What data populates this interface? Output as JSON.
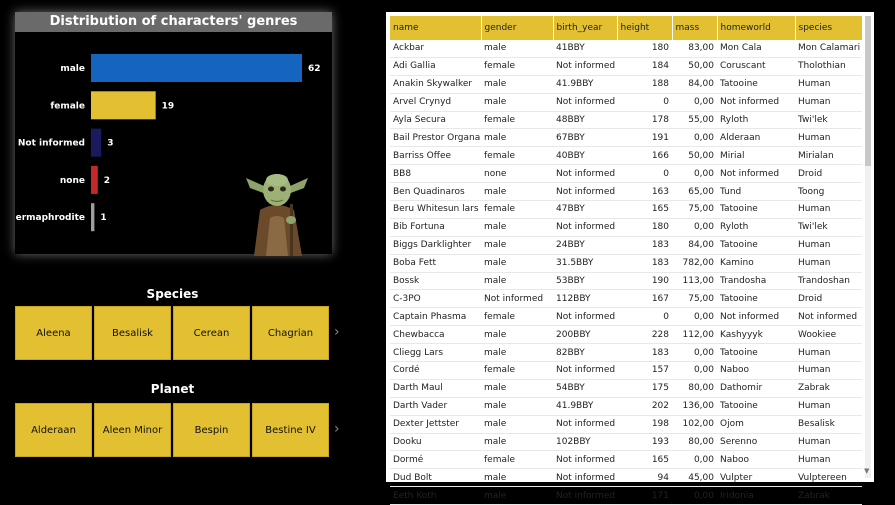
{
  "chart_data": {
    "type": "bar",
    "orientation": "horizontal",
    "title": "Distribution of characters' genres",
    "categories": [
      "male",
      "female",
      "Not informed",
      "none",
      "hermaphrodite"
    ],
    "values": [
      62,
      19,
      3,
      2,
      1
    ],
    "colors": [
      "#1565c0",
      "#e3c032",
      "#1a1a5e",
      "#c62828",
      "#9e9e9e"
    ]
  },
  "species_slicer": {
    "title": "Species",
    "items": [
      "Aleena",
      "Besalisk",
      "Cerean",
      "Chagrian"
    ]
  },
  "planet_slicer": {
    "title": "Planet",
    "items": [
      "Alderaan",
      "Aleen Minor",
      "Bespin",
      "Bestine IV"
    ]
  },
  "table": {
    "columns": [
      "name",
      "gender",
      "birth_year",
      "height",
      "mass",
      "homeworld",
      "species"
    ],
    "rows": [
      [
        "Ackbar",
        "male",
        "41BBY",
        "180",
        "83,00",
        "Mon Cala",
        "Mon Calamari"
      ],
      [
        "Adi Gallia",
        "female",
        "Not informed",
        "184",
        "50,00",
        "Coruscant",
        "Tholothian"
      ],
      [
        "Anakin Skywalker",
        "male",
        "41.9BBY",
        "188",
        "84,00",
        "Tatooine",
        "Human"
      ],
      [
        "Arvel Crynyd",
        "male",
        "Not informed",
        "0",
        "0,00",
        "Not informed",
        "Human"
      ],
      [
        "Ayla Secura",
        "female",
        "48BBY",
        "178",
        "55,00",
        "Ryloth",
        "Twi'lek"
      ],
      [
        "Bail Prestor Organa",
        "male",
        "67BBY",
        "191",
        "0,00",
        "Alderaan",
        "Human"
      ],
      [
        "Barriss Offee",
        "female",
        "40BBY",
        "166",
        "50,00",
        "Mirial",
        "Mirialan"
      ],
      [
        "BB8",
        "none",
        "Not informed",
        "0",
        "0,00",
        "Not informed",
        "Droid"
      ],
      [
        "Ben Quadinaros",
        "male",
        "Not informed",
        "163",
        "65,00",
        "Tund",
        "Toong"
      ],
      [
        "Beru Whitesun lars",
        "female",
        "47BBY",
        "165",
        "75,00",
        "Tatooine",
        "Human"
      ],
      [
        "Bib Fortuna",
        "male",
        "Not informed",
        "180",
        "0,00",
        "Ryloth",
        "Twi'lek"
      ],
      [
        "Biggs Darklighter",
        "male",
        "24BBY",
        "183",
        "84,00",
        "Tatooine",
        "Human"
      ],
      [
        "Boba Fett",
        "male",
        "31.5BBY",
        "183",
        "782,00",
        "Kamino",
        "Human"
      ],
      [
        "Bossk",
        "male",
        "53BBY",
        "190",
        "113,00",
        "Trandosha",
        "Trandoshan"
      ],
      [
        "C-3PO",
        "Not informed",
        "112BBY",
        "167",
        "75,00",
        "Tatooine",
        "Droid"
      ],
      [
        "Captain Phasma",
        "female",
        "Not informed",
        "0",
        "0,00",
        "Not informed",
        "Not informed"
      ],
      [
        "Chewbacca",
        "male",
        "200BBY",
        "228",
        "112,00",
        "Kashyyyk",
        "Wookiee"
      ],
      [
        "Cliegg Lars",
        "male",
        "82BBY",
        "183",
        "0,00",
        "Tatooine",
        "Human"
      ],
      [
        "Cordé",
        "female",
        "Not informed",
        "157",
        "0,00",
        "Naboo",
        "Human"
      ],
      [
        "Darth Maul",
        "male",
        "54BBY",
        "175",
        "80,00",
        "Dathomir",
        "Zabrak"
      ],
      [
        "Darth Vader",
        "male",
        "41.9BBY",
        "202",
        "136,00",
        "Tatooine",
        "Human"
      ],
      [
        "Dexter Jettster",
        "male",
        "Not informed",
        "198",
        "102,00",
        "Ojom",
        "Besalisk"
      ],
      [
        "Dooku",
        "male",
        "102BBY",
        "193",
        "80,00",
        "Serenno",
        "Human"
      ],
      [
        "Dormé",
        "female",
        "Not informed",
        "165",
        "0,00",
        "Naboo",
        "Human"
      ],
      [
        "Dud Bolt",
        "male",
        "Not informed",
        "94",
        "45,00",
        "Vulpter",
        "Vulptereen"
      ],
      [
        "Eeth Koth",
        "male",
        "Not informed",
        "171",
        "0,00",
        "Iridonia",
        "Zabrak"
      ]
    ]
  }
}
